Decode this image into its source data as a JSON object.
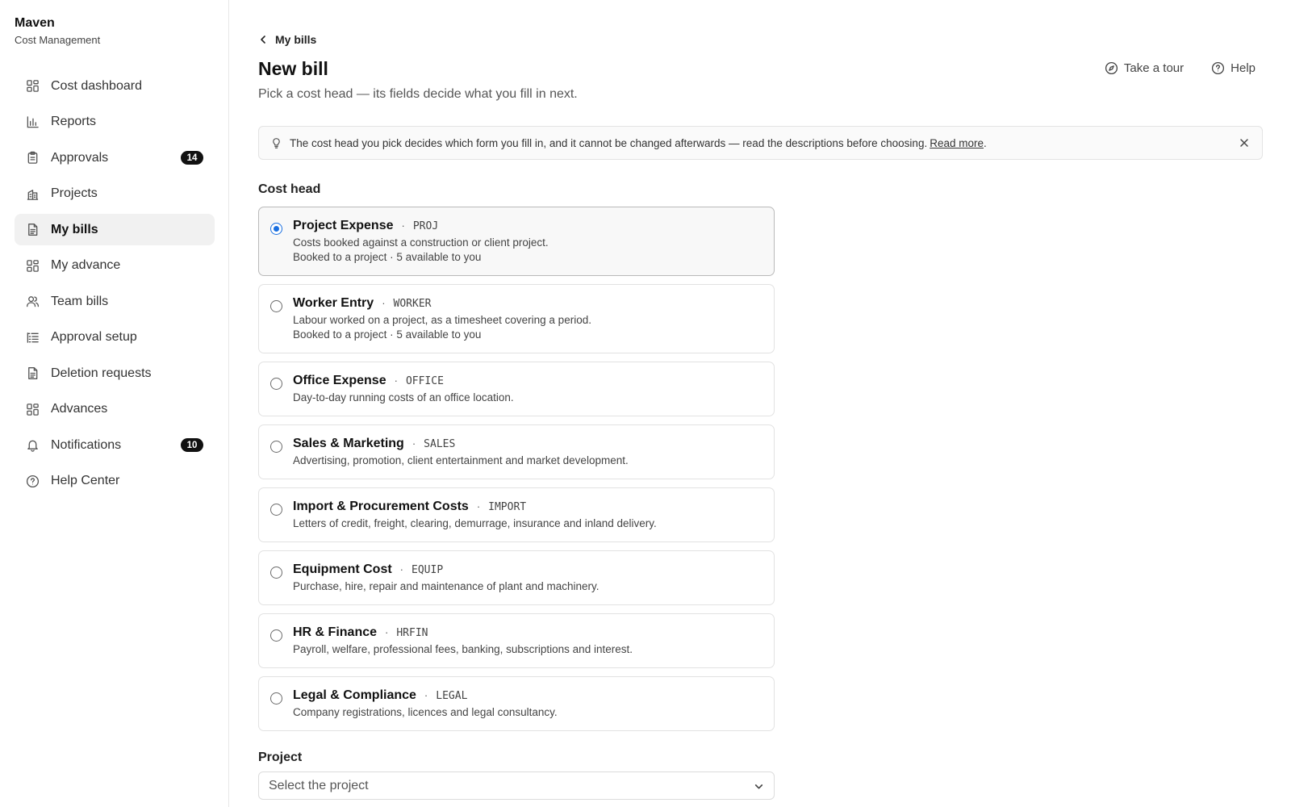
{
  "brand": {
    "name": "Maven",
    "subtitle": "Cost Management"
  },
  "sidebar": {
    "items": [
      {
        "label": "Cost dashboard",
        "icon": "grid-icon"
      },
      {
        "label": "Reports",
        "icon": "bar-chart-icon"
      },
      {
        "label": "Approvals",
        "icon": "clipboard-icon",
        "badge": "14"
      },
      {
        "label": "Projects",
        "icon": "building-icon"
      },
      {
        "label": "My bills",
        "icon": "document-icon",
        "active": true
      },
      {
        "label": "My advance",
        "icon": "grid-icon"
      },
      {
        "label": "Team bills",
        "icon": "users-icon"
      },
      {
        "label": "Approval setup",
        "icon": "list-tree-icon"
      },
      {
        "label": "Deletion requests",
        "icon": "document-icon"
      },
      {
        "label": "Advances",
        "icon": "grid-icon"
      },
      {
        "label": "Notifications",
        "icon": "bell-icon",
        "badge": "10"
      },
      {
        "label": "Help Center",
        "icon": "help-circle-icon"
      }
    ]
  },
  "header": {
    "back_label": "My bills",
    "title": "New bill",
    "subtitle": "Pick a cost head — its fields decide what you fill in next.",
    "tour_label": "Take a tour",
    "help_label": "Help"
  },
  "banner": {
    "text": "The cost head you pick decides which form you fill in, and it cannot be changed afterwards — read the descriptions before choosing.",
    "link": "Read more",
    "suffix": "."
  },
  "cost_head": {
    "label": "Cost head",
    "options": [
      {
        "title": "Project Expense",
        "code": "PROJ",
        "desc": "Costs booked against a construction or client project.",
        "meta": "Booked to a project · 5 available to you",
        "selected": true
      },
      {
        "title": "Worker Entry",
        "code": "WORKER",
        "desc": "Labour worked on a project, as a timesheet covering a period.",
        "meta": "Booked to a project · 5 available to you"
      },
      {
        "title": "Office Expense",
        "code": "OFFICE",
        "desc": "Day-to-day running costs of an office location."
      },
      {
        "title": "Sales & Marketing",
        "code": "SALES",
        "desc": "Advertising, promotion, client entertainment and market development."
      },
      {
        "title": "Import & Procurement Costs",
        "code": "IMPORT",
        "desc": "Letters of credit, freight, clearing, demurrage, insurance and inland delivery."
      },
      {
        "title": "Equipment Cost",
        "code": "EQUIP",
        "desc": "Purchase, hire, repair and maintenance of plant and machinery."
      },
      {
        "title": "HR & Finance",
        "code": "HRFIN",
        "desc": "Payroll, welfare, professional fees, banking, subscriptions and interest."
      },
      {
        "title": "Legal & Compliance",
        "code": "LEGAL",
        "desc": "Company registrations, licences and legal consultancy."
      }
    ]
  },
  "project": {
    "label": "Project",
    "placeholder": "Select the project"
  },
  "colors": {
    "accent": "#1a6fe0",
    "badge_bg": "#111111",
    "active_nav_bg": "#f1f1f1"
  }
}
